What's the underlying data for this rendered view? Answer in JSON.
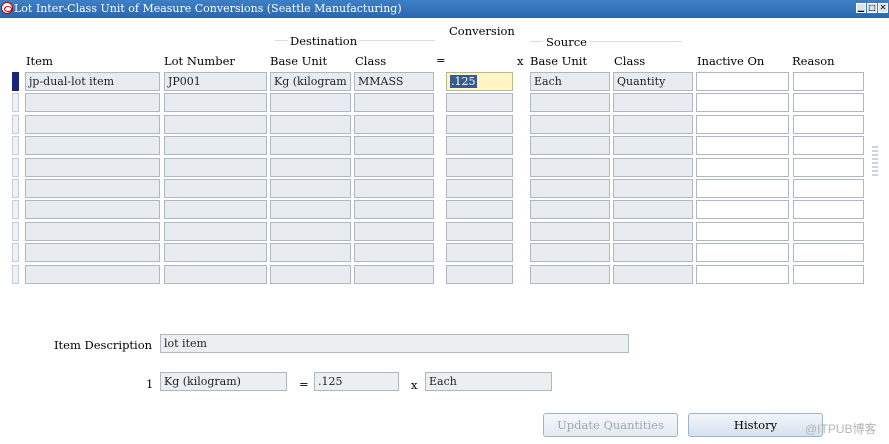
{
  "window": {
    "title": "Lot Inter-Class Unit of Measure Conversions (Seattle Manufacturing)"
  },
  "groups": {
    "destination": "Destination",
    "conversion": "Conversion",
    "source": "Source"
  },
  "columns": {
    "item": "Item",
    "lot_number": "Lot Number",
    "dest_base_unit": "Base Unit",
    "dest_class": "Class",
    "equals": "=",
    "times": "x",
    "src_base_unit": "Base Unit",
    "src_class": "Class",
    "inactive_on": "Inactive On",
    "reason": "Reason"
  },
  "rows": [
    {
      "item": "jp-dual-lot item",
      "lot_number": "JP001",
      "dest_base_unit": "Kg (kilogram",
      "dest_class": "MMASS",
      "conversion": ".125",
      "src_base_unit": "Each",
      "src_class": "Quantity",
      "inactive_on": "",
      "reason": ""
    }
  ],
  "empty_row_count": 9,
  "footer": {
    "item_description_label": "Item Description",
    "item_description": "lot item",
    "equation_qty": "1",
    "equation_dest_unit": "Kg (kilogram)",
    "equation_equals": "=",
    "equation_conversion": ".125",
    "equation_times": "x",
    "equation_src_unit": "Each"
  },
  "buttons": {
    "update_quantities": "Update Quantities",
    "history": "History"
  },
  "watermark": "@ITPUB博客"
}
